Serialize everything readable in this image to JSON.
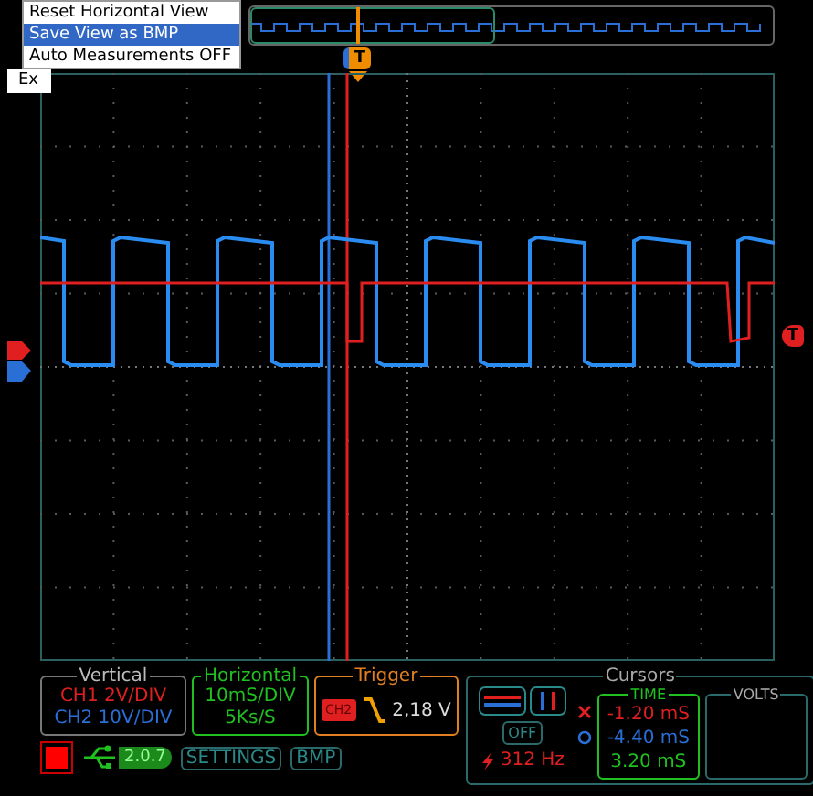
{
  "menu": {
    "items": [
      {
        "label": "Reset Horizontal View",
        "selected": false
      },
      {
        "label": "Save View as BMP",
        "selected": true
      },
      {
        "label": "Auto Measurements OFF",
        "selected": false
      }
    ],
    "behind_label": "Ex"
  },
  "overview": {
    "trigger_marker": "T"
  },
  "scope": {
    "trigger_level_marker": "T"
  },
  "vertical": {
    "title": "Vertical",
    "channels": [
      {
        "label": "CH1 2V/DIV",
        "color": "#e02020"
      },
      {
        "label": "CH2 10V/DIV",
        "color": "#2a6fd6"
      }
    ]
  },
  "horizontal": {
    "title": "Horizontal",
    "timebase": "10mS/DIV",
    "sample_rate": "5Ks/S"
  },
  "trigger": {
    "title": "Trigger",
    "source": "CH2",
    "level": "2,18 V"
  },
  "toolbar": {
    "running": false,
    "version": "2.0.7",
    "settings": "SETTINGS",
    "bmp": "BMP"
  },
  "cursors": {
    "title": "Cursors",
    "off": "OFF",
    "frequency": "312 Hz",
    "time_title": "TIME",
    "volts_title": "VOLTS",
    "time_values": [
      {
        "value": "-1.20 mS",
        "color": "#e02020"
      },
      {
        "value": "-4.40 mS",
        "color": "#2a6fd6"
      },
      {
        "value": "3.20 mS",
        "color": "#20c020"
      }
    ]
  }
}
